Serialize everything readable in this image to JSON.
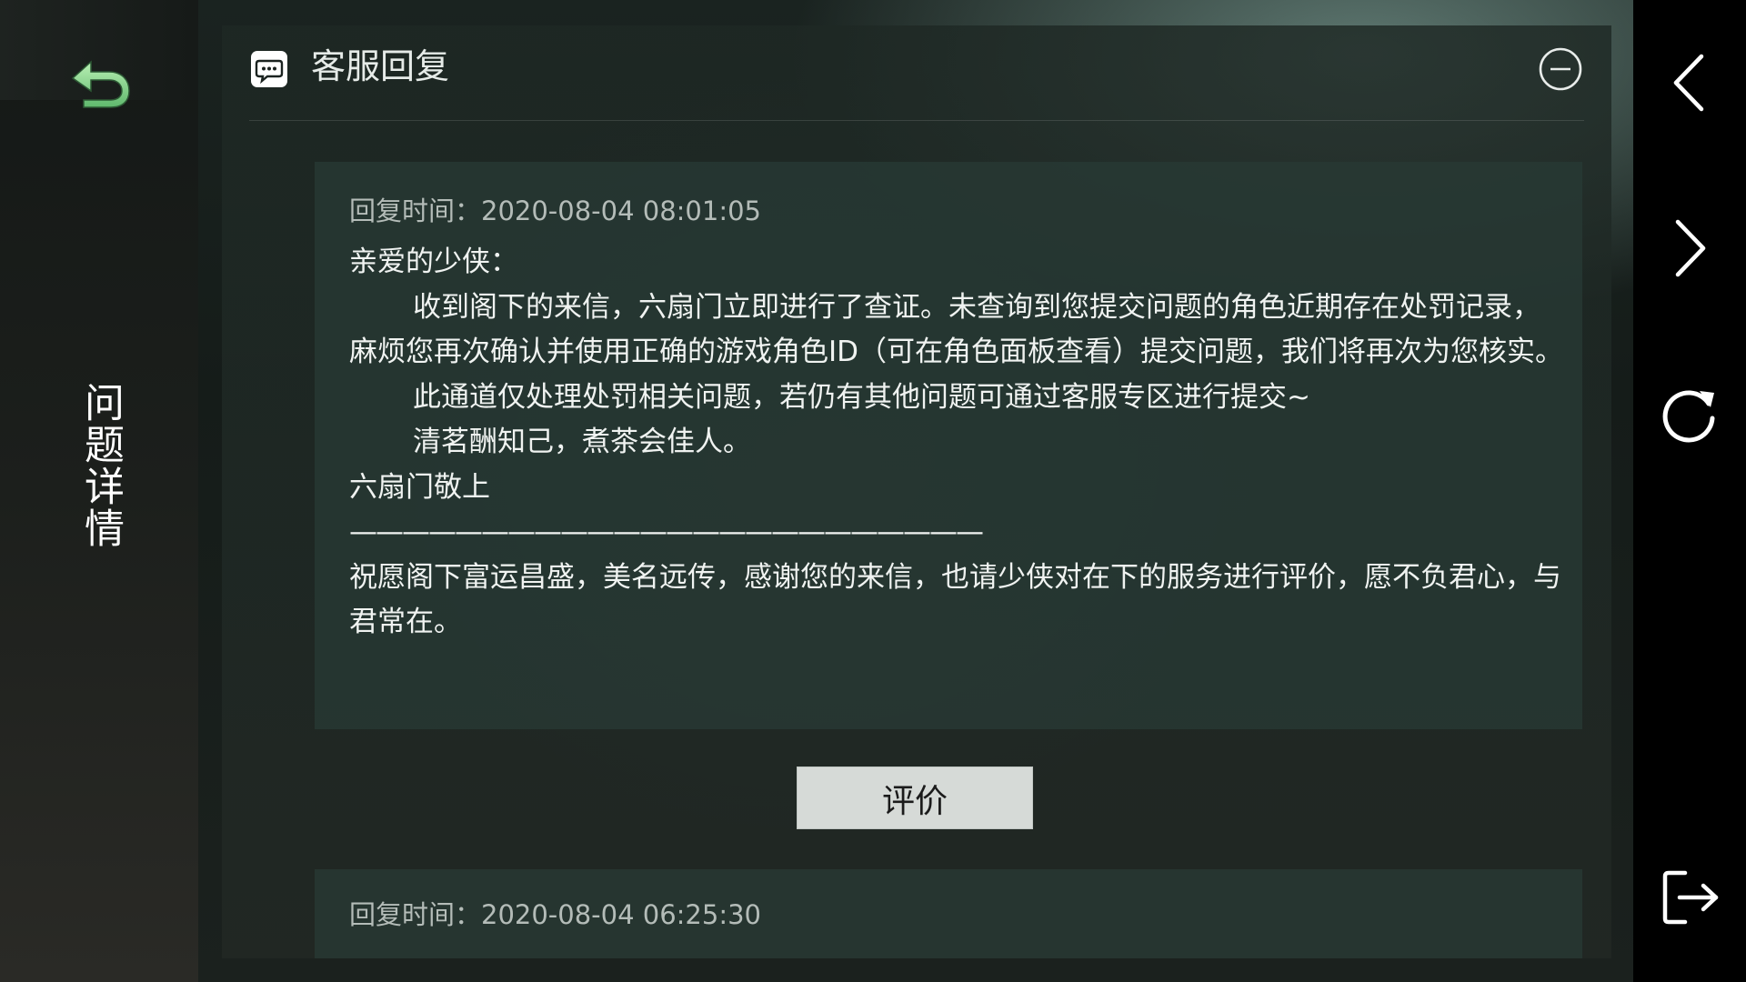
{
  "sidebar": {
    "back_icon": "back-arrow-icon",
    "title": "问题详情"
  },
  "panel": {
    "title": "客服回复",
    "chat_icon": "chat-bubble-icon",
    "minimize_icon": "minus-circle-icon"
  },
  "replies": [
    {
      "time": "回复时间：2020-08-04 08:01:05",
      "greeting": "亲爱的少侠：",
      "paragraph1": "收到阁下的来信，六扇门立即进行了查证。未查询到您提交问题的角色近期存在处罚记录，麻烦您再次确认并使用正确的游戏角色ID（可在角色面板查看）提交问题，我们将再次为您核实。",
      "paragraph2": "此通道仅处理处罚相关问题，若仍有其他问题可通过客服专区进行提交~",
      "paragraph3": "清茗酬知己，煮茶会佳人。",
      "signature": "六扇门敬上",
      "divider": "————————————————————————",
      "closing": "祝愿阁下富运昌盛，美名远传，感谢您的来信，也请少侠对在下的服务进行评价，愿不负君心，与君常在。"
    },
    {
      "time": "回复时间：2020-08-04 06:25:30"
    }
  ],
  "rate_button": "评价",
  "right_nav": {
    "prev_icon": "chevron-left-icon",
    "next_icon": "chevron-right-icon",
    "refresh_icon": "refresh-icon",
    "exit_icon": "exit-icon"
  },
  "colors": {
    "accent_green": "#7fd08a",
    "card_bg": "#28383a",
    "button_bg": "#d6dad7"
  }
}
